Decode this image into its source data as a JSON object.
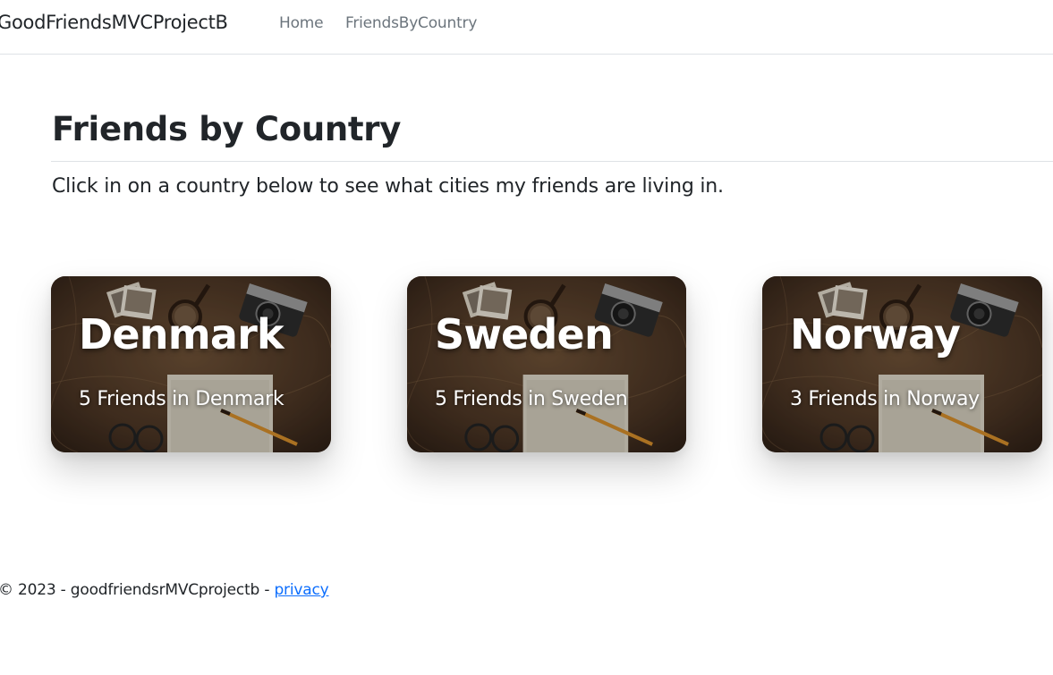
{
  "navbar": {
    "brand": "GoodFriendsMVCProjectB",
    "links": [
      {
        "label": "Home"
      },
      {
        "label": "FriendsByCountry"
      }
    ]
  },
  "main": {
    "title": "Friends by Country",
    "lead": "Click in on a country below to see what cities my friends are living in.",
    "cards": [
      {
        "country": "Denmark",
        "subtitle": "5 Friends in Denmark"
      },
      {
        "country": "Sweden",
        "subtitle": "5 Friends in Sweden"
      },
      {
        "country": "Norway",
        "subtitle": "3 Friends in Norway"
      }
    ]
  },
  "footer": {
    "text": "© 2023 - goodfriendsrMVCprojectb - ",
    "privacy_label": "privacy"
  },
  "colors": {
    "link": "#0d6efd",
    "nav_muted": "#6c757d",
    "text": "#212529"
  }
}
